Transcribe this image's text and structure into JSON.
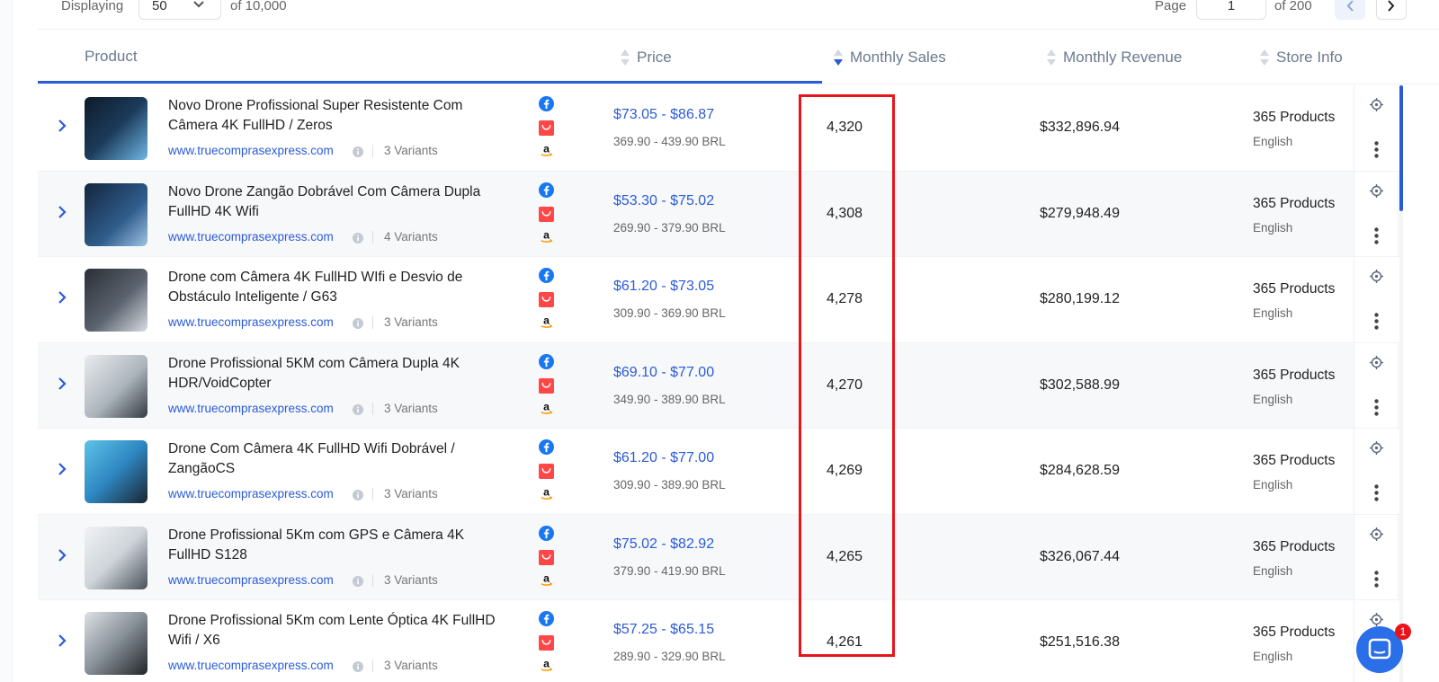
{
  "topbar": {
    "displaying_label": "Displaying",
    "per_page": "50",
    "total_text": "of 10,000",
    "page_label": "Page",
    "page_value": "1",
    "page_total_text": "of 200"
  },
  "columns": {
    "product": "Product",
    "price": "Price",
    "monthly_sales": "Monthly Sales",
    "monthly_revenue": "Monthly Revenue",
    "store_info": "Store Info"
  },
  "colors": {
    "accent": "#2a5bd7",
    "highlight": "#e8141b"
  },
  "rows": [
    {
      "image_count": "9",
      "title": "Novo Drone Profissional Super Resistente Com Câmera 4K FullHD / Zeros",
      "store": "www.truecomprasexpress.com",
      "variants": "3 Variants",
      "price_usd": "$73.05 - $86.87",
      "price_brl": "369.90 - 439.90 BRL",
      "sales": "4,320",
      "revenue": "$332,896.94",
      "store_products": "365 Products",
      "store_lang": "English"
    },
    {
      "image_count": "8",
      "title": "Novo Drone Zangão Dobrável Com Câmera Dupla FullHD 4K Wifi",
      "store": "www.truecomprasexpress.com",
      "variants": "4 Variants",
      "price_usd": "$53.30 - $75.02",
      "price_brl": "269.90 - 379.90 BRL",
      "sales": "4,308",
      "revenue": "$279,948.49",
      "store_products": "365 Products",
      "store_lang": "English"
    },
    {
      "image_count": "7",
      "title": "Drone com Câmera 4K FullHD WIfi e Desvio de Obstáculo Inteligente / G63",
      "store": "www.truecomprasexpress.com",
      "variants": "3 Variants",
      "price_usd": "$61.20 - $73.05",
      "price_brl": "309.90 - 369.90 BRL",
      "sales": "4,278",
      "revenue": "$280,199.12",
      "store_products": "365 Products",
      "store_lang": "English"
    },
    {
      "image_count": "8",
      "title": "Drone Profissional 5KM com Câmera Dupla 4K HDR/VoidCopter",
      "store": "www.truecomprasexpress.com",
      "variants": "3 Variants",
      "price_usd": "$69.10 - $77.00",
      "price_brl": "349.90 - 389.90 BRL",
      "sales": "4,270",
      "revenue": "$302,588.99",
      "store_products": "365 Products",
      "store_lang": "English"
    },
    {
      "image_count": "8",
      "title": "Drone Com Câmera 4K FullHD Wifi Dobrável / ZangãoCS",
      "store": "www.truecomprasexpress.com",
      "variants": "3 Variants",
      "price_usd": "$61.20 - $77.00",
      "price_brl": "309.90 - 389.90 BRL",
      "sales": "4,269",
      "revenue": "$284,628.59",
      "store_products": "365 Products",
      "store_lang": "English"
    },
    {
      "image_count": "10",
      "title": "Drone Profissional 5Km com GPS e Câmera 4K FullHD S128",
      "store": "www.truecomprasexpress.com",
      "variants": "3 Variants",
      "price_usd": "$75.02 - $82.92",
      "price_brl": "379.90 - 419.90 BRL",
      "sales": "4,265",
      "revenue": "$326,067.44",
      "store_products": "365 Products",
      "store_lang": "English"
    },
    {
      "image_count": "8",
      "title": "Drone Profissional 5Km com Lente Óptica 4K FullHD Wifi / X6",
      "store": "www.truecomprasexpress.com",
      "variants": "3 Variants",
      "price_usd": "$57.25 - $65.15",
      "price_brl": "289.90 - 329.90 BRL",
      "sales": "4,261",
      "revenue": "$251,516.38",
      "store_products": "365 Products",
      "store_lang": "English"
    }
  ],
  "chat": {
    "badge": "1"
  },
  "icons": {
    "sources": [
      "facebook-icon",
      "aliexpress-icon",
      "amazon-icon"
    ],
    "row_actions": [
      "target-icon",
      "more-vertical-icon"
    ]
  }
}
